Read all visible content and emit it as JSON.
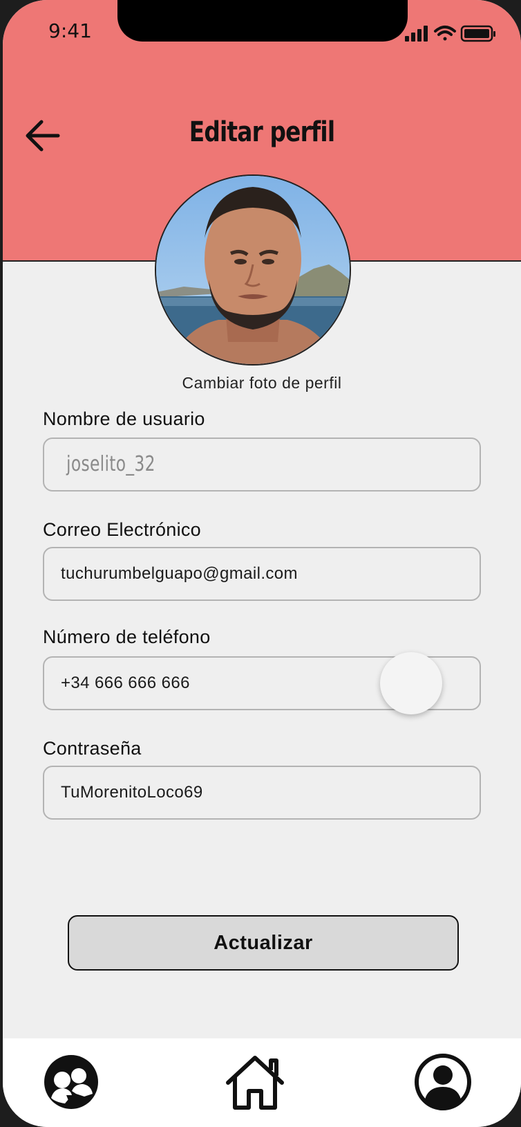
{
  "status_bar": {
    "time": "9:41"
  },
  "header": {
    "title": "Editar perfil"
  },
  "profile": {
    "change_photo_label": "Cambiar foto de perfil"
  },
  "form": {
    "username": {
      "label": "Nombre de usuario",
      "placeholder": "joselito_32"
    },
    "email": {
      "label": "Correo Electrónico",
      "value": "tuchurumbelguapo@gmail.com"
    },
    "phone": {
      "label": "Número de teléfono",
      "value": "+34 666 666 666"
    },
    "password": {
      "label": "Contraseña",
      "value": "TuMorenitoLoco69"
    }
  },
  "actions": {
    "update_label": "Actualizar"
  },
  "colors": {
    "header_bg": "#ee7775",
    "page_bg": "#efefef",
    "button_bg": "#d9d9d9"
  },
  "tabbar": {
    "icons": [
      "community-icon",
      "home-icon",
      "profile-icon"
    ]
  }
}
